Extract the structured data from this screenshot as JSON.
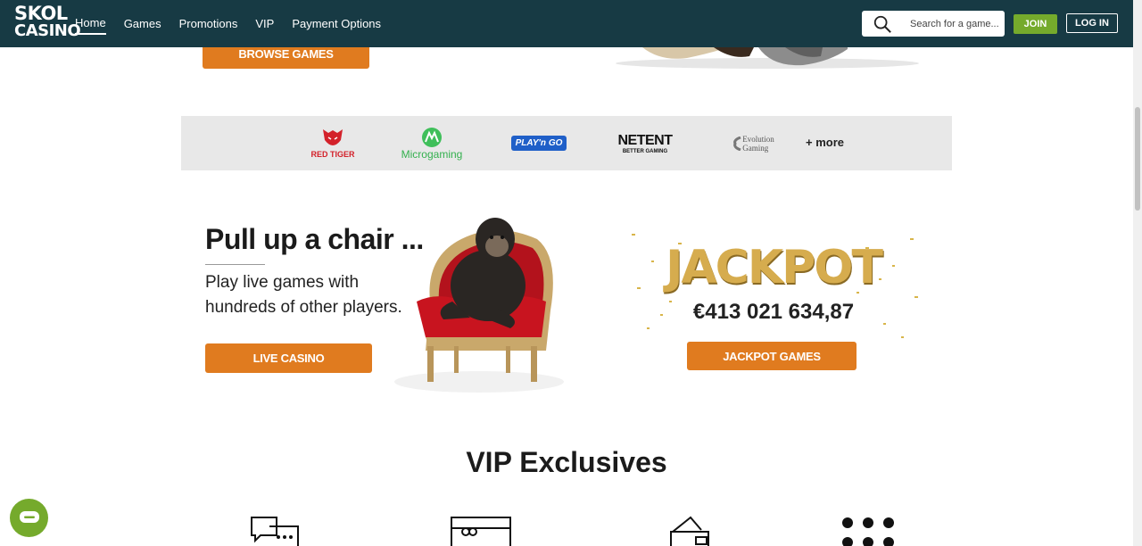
{
  "header": {
    "logo_line1": "SKOL",
    "logo_line2": "CASINO",
    "nav": [
      {
        "label": "Home",
        "active": true
      },
      {
        "label": "Games"
      },
      {
        "label": "Promotions"
      },
      {
        "label": "VIP"
      },
      {
        "label": "Payment Options"
      }
    ],
    "search_placeholder": "Search for a game...",
    "join_label": "JOIN",
    "login_label": "LOG IN"
  },
  "hero": {
    "browse_label": "BROWSE GAMES"
  },
  "providers": {
    "items": [
      {
        "name": "RED TIGER"
      },
      {
        "name": "Microgaming"
      },
      {
        "name": "PLAY'n GO"
      },
      {
        "name": "NETENT",
        "tagline": "BETTER GAMING"
      },
      {
        "name": "Evolution",
        "name2": "Gaming"
      }
    ],
    "more_label": "+ more"
  },
  "live": {
    "headline": "Pull up a chair ...",
    "text_line1": "Play live games with",
    "text_line2": "hundreds of other players.",
    "button_label": "LIVE CASINO"
  },
  "jackpot": {
    "title": "JACKPOT",
    "amount": "€413 021 634,87",
    "button_label": "JACKPOT GAMES"
  },
  "vip": {
    "title": "VIP Exclusives",
    "icons": [
      "chat-icon",
      "gift-card-icon",
      "wallet-icon",
      "grid-dots-icon"
    ]
  },
  "colors": {
    "header_bg": "#173a44",
    "accent_orange": "#e07b1f",
    "join_green": "#75aa2c"
  }
}
